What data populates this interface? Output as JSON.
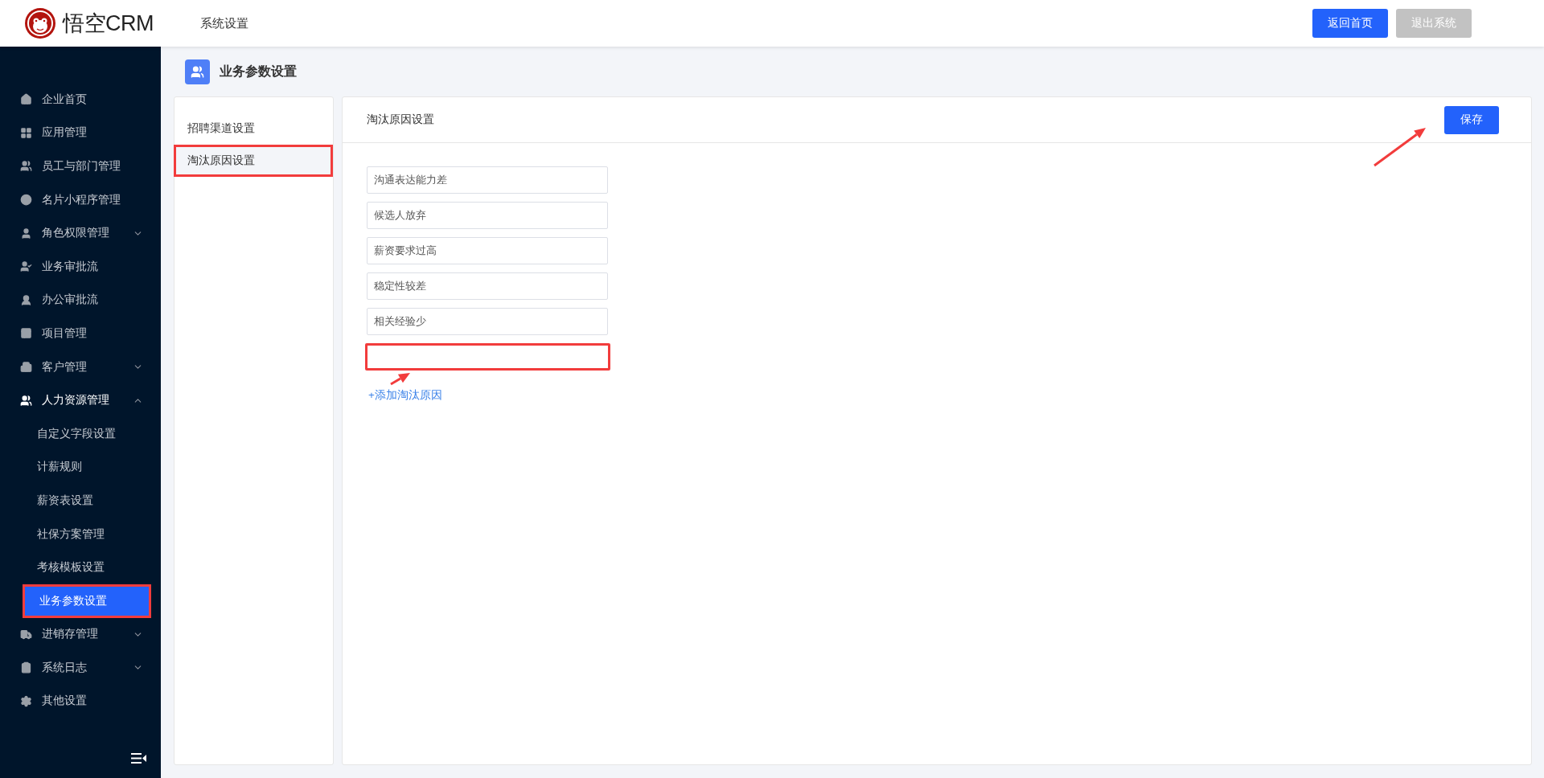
{
  "topbar": {
    "brand": "悟空CRM",
    "section": "系统设置",
    "buttons": [
      {
        "label": "返回首页",
        "kind": "primary"
      },
      {
        "label": "退出系统",
        "kind": "muted"
      }
    ]
  },
  "sidebar": {
    "items": [
      {
        "label": "企业首页",
        "kind": "link"
      },
      {
        "label": "应用管理",
        "kind": "link"
      },
      {
        "label": "员工与部门管理",
        "kind": "link"
      },
      {
        "label": "名片小程序管理",
        "kind": "link"
      },
      {
        "label": "角色权限管理",
        "kind": "group",
        "expanded": false
      },
      {
        "label": "业务审批流",
        "kind": "link"
      },
      {
        "label": "办公审批流",
        "kind": "link"
      },
      {
        "label": "项目管理",
        "kind": "link"
      },
      {
        "label": "客户管理",
        "kind": "group",
        "expanded": false
      },
      {
        "label": "人力资源管理",
        "kind": "group",
        "expanded": true,
        "children": [
          {
            "label": "自定义字段设置",
            "selected": false,
            "highlighted": false
          },
          {
            "label": "计薪规则",
            "selected": false,
            "highlighted": false
          },
          {
            "label": "薪资表设置",
            "selected": false,
            "highlighted": false
          },
          {
            "label": "社保方案管理",
            "selected": false,
            "highlighted": false
          },
          {
            "label": "考核模板设置",
            "selected": false,
            "highlighted": false
          },
          {
            "label": "业务参数设置",
            "selected": true,
            "highlighted": true
          }
        ]
      },
      {
        "label": "进销存管理",
        "kind": "group",
        "expanded": false
      },
      {
        "label": "系统日志",
        "kind": "group",
        "expanded": false
      },
      {
        "label": "其他设置",
        "kind": "link"
      }
    ]
  },
  "page": {
    "title": "业务参数设置"
  },
  "settings_menu": [
    {
      "label": "招聘渠道设置",
      "selected": false,
      "highlighted": false
    },
    {
      "label": "淘汰原因设置",
      "selected": true,
      "highlighted": true
    }
  ],
  "panel": {
    "title": "淘汰原因设置",
    "save_button": "保存",
    "reasons": [
      {
        "value": "沟通表达能力差",
        "highlighted": false
      },
      {
        "value": "候选人放弃",
        "highlighted": false
      },
      {
        "value": "薪资要求过高",
        "highlighted": false
      },
      {
        "value": "稳定性较差",
        "highlighted": false
      },
      {
        "value": "相关经验少",
        "highlighted": false
      },
      {
        "highlighted": true
      }
    ],
    "add_link": "+添加淘汰原因"
  }
}
